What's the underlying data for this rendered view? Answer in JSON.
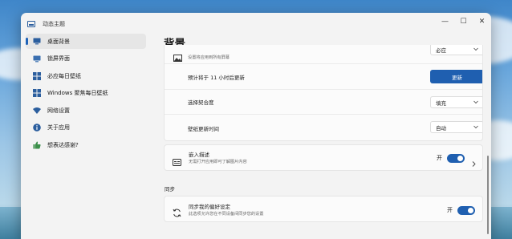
{
  "window": {
    "title": "动态主题",
    "controls": {
      "minimize": "—",
      "maximize": "☐",
      "close": "✕"
    }
  },
  "sidebar": {
    "items": [
      {
        "label": "桌面背景",
        "icon": "desktop-icon",
        "selected": true
      },
      {
        "label": "锁屏界面",
        "icon": "lockscreen-icon",
        "selected": false
      },
      {
        "label": "必应每日壁纸",
        "icon": "bing-wallpaper-icon",
        "selected": false
      },
      {
        "label": "Windows 聚焦每日壁纸",
        "icon": "spotlight-wallpaper-icon",
        "selected": false
      },
      {
        "label": "网络设置",
        "icon": "wifi-icon",
        "selected": false
      },
      {
        "label": "关于应用",
        "icon": "info-icon",
        "selected": false
      },
      {
        "label": "想表达感谢?",
        "icon": "thumbs-up-icon",
        "selected": false
      }
    ]
  },
  "main": {
    "page_title": "背景",
    "top_card": {
      "partial_row": {
        "sublabel": "设置将应用到所有屏幕",
        "value": "必应"
      },
      "next_update_label": "预计将于 11 小时后更新",
      "update_button": "更新",
      "fit_label": "选择契合度",
      "fit_value": "填充",
      "interval_label": "壁纸更新时间",
      "interval_value": "自动"
    },
    "embed_card": {
      "label": "嵌入描述",
      "sublabel": "无需打开应用即可了解图片内容",
      "toggle_label": "开",
      "toggle_on": true
    },
    "sync_section": {
      "header": "同步",
      "label": "同步我的偏好设定",
      "sublabel": "此选项允许您在不同设备间同步您的设置",
      "toggle_label": "开",
      "toggle_on": true
    }
  },
  "colors": {
    "accent": "#1f5fb0",
    "window_bg": "#f3f3f3",
    "card_bg": "#fbfbfb"
  }
}
